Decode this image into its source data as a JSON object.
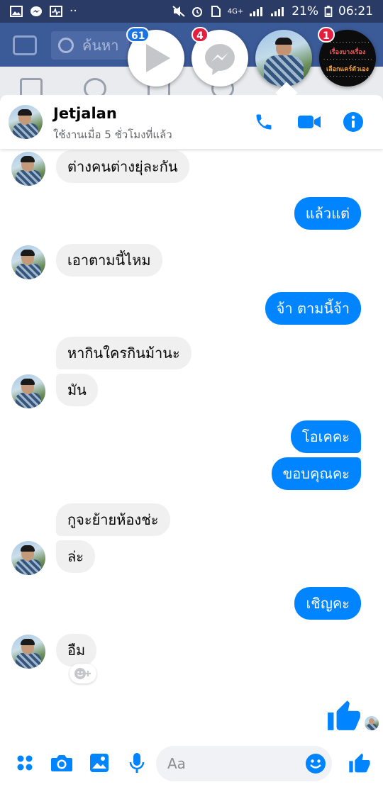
{
  "status_bar": {
    "battery": "21%",
    "time": "06:21",
    "network": "4G+"
  },
  "background_app": {
    "search_placeholder": "ค้นหา"
  },
  "chat_heads": [
    {
      "name": "video-app",
      "badge": "61"
    },
    {
      "name": "messenger",
      "badge": "4"
    },
    {
      "name": "contact",
      "badge": ""
    },
    {
      "name": "page-post",
      "badge": "1",
      "title": "เรื่องบางเรื่อง",
      "subtitle": "เลือกแคร์ตัวเอง"
    }
  ],
  "chat": {
    "name": "Jetjalan",
    "status": "ใช้งานเมื่อ 5 ชั่วโมงที่แล้ว"
  },
  "messages": [
    {
      "side": "in",
      "text": "ต่างคนต่างยุ่ละกัน"
    },
    {
      "side": "out",
      "text": "แล้วแต่"
    },
    {
      "side": "in",
      "text": "เอาตามนี้ไหม"
    },
    {
      "side": "out",
      "text": "จ้า ตามนี้จ้า"
    },
    {
      "side": "in",
      "text": "หากินใครกินม้านะ"
    },
    {
      "side": "in",
      "text": "มัน"
    },
    {
      "side": "out",
      "text": "โอเคคะ"
    },
    {
      "side": "out",
      "text": "ขอบคุณคะ"
    },
    {
      "side": "in",
      "text": "กูจะย้ายห้องช่ะ"
    },
    {
      "side": "in",
      "text": "ล่ะ"
    },
    {
      "side": "out",
      "text": "เชิญคะ"
    },
    {
      "side": "in",
      "text": "อืม"
    }
  ],
  "composer": {
    "placeholder": "Aa"
  },
  "colors": {
    "accent": "#0084ff",
    "incoming_bubble": "#f0f0f0",
    "fb_blue": "#3b5a98"
  }
}
